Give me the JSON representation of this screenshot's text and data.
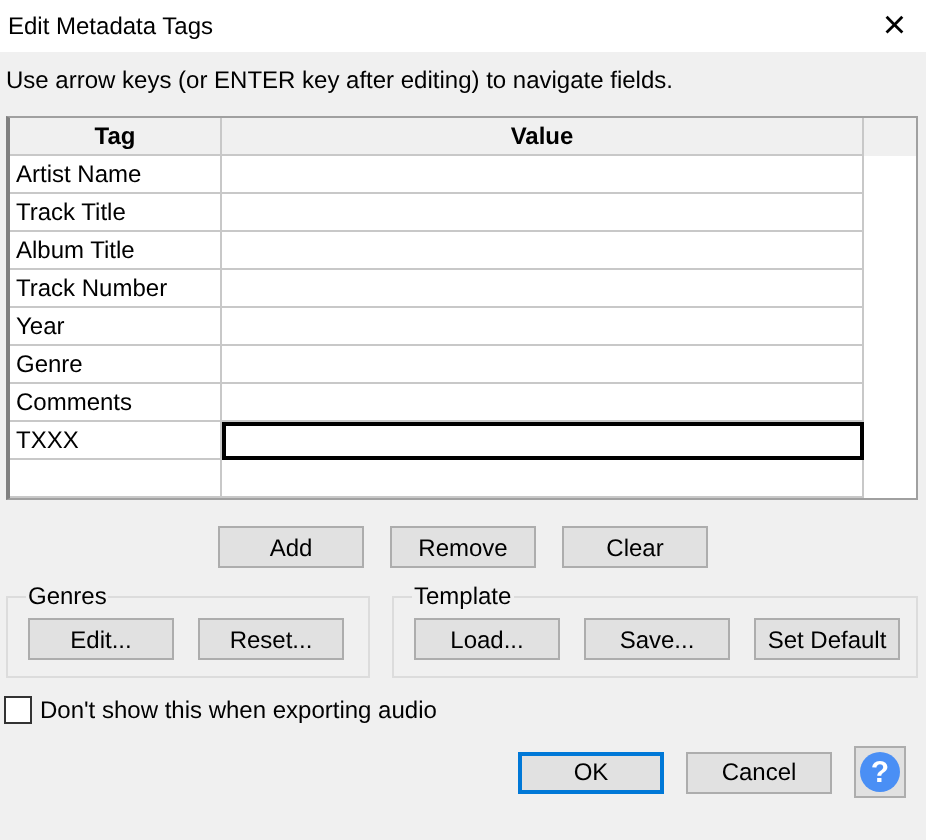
{
  "window": {
    "title": "Edit Metadata Tags",
    "close": "×"
  },
  "instructions": "Use arrow keys (or ENTER key after editing) to navigate fields.",
  "table": {
    "columns": [
      "Tag",
      "Value"
    ],
    "rows": [
      {
        "tag": "Artist Name",
        "focused": false
      },
      {
        "tag": "Track Title",
        "focused": false
      },
      {
        "tag": "Album Title",
        "focused": false
      },
      {
        "tag": "Track Number",
        "focused": false
      },
      {
        "tag": "Year",
        "focused": false
      },
      {
        "tag": "Genre",
        "focused": false
      },
      {
        "tag": "Comments",
        "focused": false
      },
      {
        "tag": "TXXX",
        "focused": true
      },
      {
        "focused": false
      }
    ]
  },
  "row_buttons": [
    "Add",
    "Remove",
    "Clear"
  ],
  "groups": [
    {
      "title": "Genres",
      "buttons": [
        "Edit...",
        "Reset..."
      ]
    },
    {
      "title": "Template",
      "buttons": [
        "Load...",
        "Save...",
        "Set Default"
      ]
    }
  ],
  "checkbox": {
    "label": "Don't show this when exporting audio",
    "checked": false
  },
  "dialog_buttons": [
    {
      "label": "OK",
      "default": true
    },
    {
      "label": "Cancel",
      "default": false
    }
  ],
  "help": {
    "label": "?"
  }
}
